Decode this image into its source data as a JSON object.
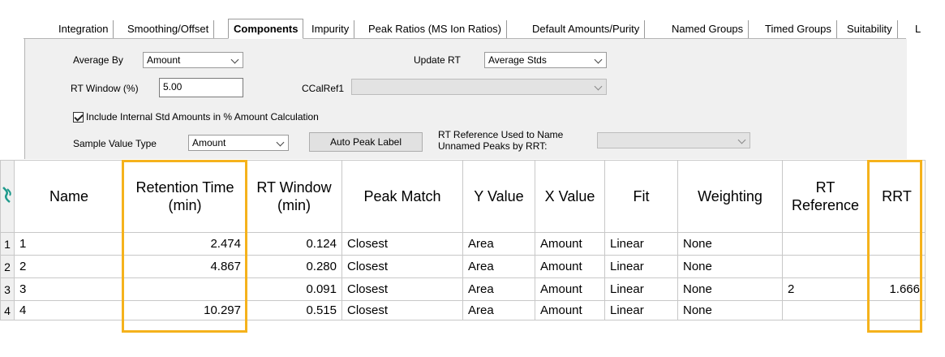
{
  "tabs": [
    {
      "label": "Integration",
      "active": false
    },
    {
      "label": "Smoothing/Offset",
      "active": false
    },
    {
      "label": "Components",
      "active": true
    },
    {
      "label": "Impurity",
      "active": false
    },
    {
      "label": "Peak Ratios (MS Ion Ratios)",
      "active": false
    },
    {
      "label": "Default Amounts/Purity",
      "active": false
    },
    {
      "label": "Named Groups",
      "active": false
    },
    {
      "label": "Timed Groups",
      "active": false
    },
    {
      "label": "Suitability",
      "active": false
    },
    {
      "label": "L",
      "active": false
    }
  ],
  "settings": {
    "average_by_label": "Average By",
    "average_by_value": "Amount",
    "update_rt_label": "Update RT",
    "update_rt_value": "Average Stds",
    "rt_window_label": "RT Window (%)",
    "rt_window_value": "5.00",
    "ccalref_label": "CCalRef1",
    "ccalref_value": "",
    "include_internal_label": "Include Internal Std Amounts in % Amount Calculation",
    "include_internal_checked": true,
    "sample_value_type_label": "Sample Value Type",
    "sample_value_type_value": "Amount",
    "auto_peak_label": "Auto Peak Label",
    "rt_reference_label_line1": "RT Reference Used to Name",
    "rt_reference_label_line2": "Unnamed Peaks by RRT:",
    "rt_reference_value": ""
  },
  "grid": {
    "headers": {
      "name": "Name",
      "rt_line1": "Retention Time",
      "rt_line2": "(min)",
      "rtw_line1": "RT Window",
      "rtw_line2": "(min)",
      "peak_match": "Peak Match",
      "y_value": "Y Value",
      "x_value": "X Value",
      "fit": "Fit",
      "weighting": "Weighting",
      "rtref_line1": "RT",
      "rtref_line2": "Reference",
      "rrt": "RRT"
    },
    "rows": [
      {
        "row": "1",
        "name": "1",
        "rt": "2.474",
        "rtw": "0.124",
        "peak_match": "Closest",
        "y": "Area",
        "x": "Amount",
        "fit": "Linear",
        "weighting": "None",
        "rt_ref": "",
        "rrt": ""
      },
      {
        "row": "2",
        "name": "2",
        "rt": "4.867",
        "rtw": "0.280",
        "peak_match": "Closest",
        "y": "Area",
        "x": "Amount",
        "fit": "Linear",
        "weighting": "None",
        "rt_ref": "",
        "rrt": ""
      },
      {
        "row": "3",
        "name": "3",
        "rt": "",
        "rtw": "0.091",
        "peak_match": "Closest",
        "y": "Area",
        "x": "Amount",
        "fit": "Linear",
        "weighting": "None",
        "rt_ref": "2",
        "rrt": "1.666"
      },
      {
        "row": "4",
        "name": "4",
        "rt": "10.297",
        "rtw": "0.515",
        "peak_match": "Closest",
        "y": "Area",
        "x": "Amount",
        "fit": "Linear",
        "weighting": "None",
        "rt_ref": "",
        "rrt": ""
      }
    ]
  },
  "colors": {
    "highlight": "#f5b21c",
    "corner_icon": "#1f9a8c"
  },
  "icons": {
    "corner": "component-table-icon"
  }
}
